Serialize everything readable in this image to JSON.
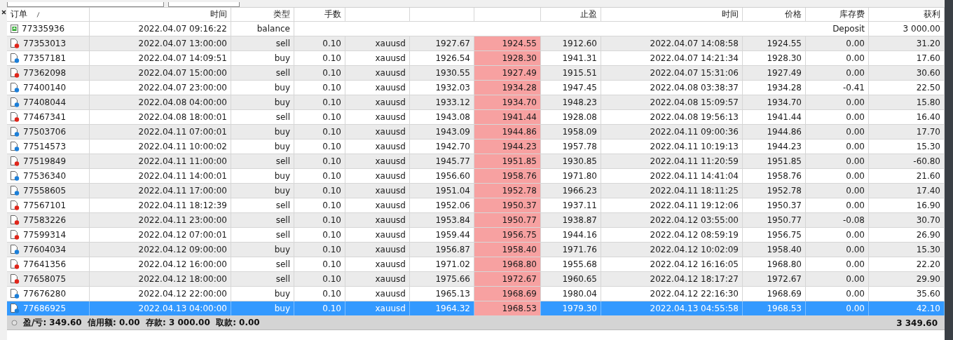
{
  "columns": {
    "order": "订单",
    "open_time": "时间",
    "type": "类型",
    "size": "手数",
    "take_profit": "止盈",
    "close_time": "时间",
    "close_price": "价格",
    "swap": "库存费",
    "profit": "获利"
  },
  "rows": [
    {
      "kind": "balance",
      "selected": false,
      "order": "77335936",
      "open_time": "2022.04.07 09:16:22",
      "type": "balance",
      "swap": "Deposit",
      "profit": "3 000.00"
    },
    {
      "kind": "sell",
      "selected": false,
      "sl_hit": true,
      "order": "77353013",
      "open_time": "2022.04.07 13:00:00",
      "type": "sell",
      "size": "0.10",
      "symbol": "xauusd",
      "open_price": "1927.67",
      "stop_loss": "1924.55",
      "take_profit": "1912.60",
      "close_time": "2022.04.07 14:08:58",
      "close_price": "1924.55",
      "swap": "0.00",
      "profit": "31.20"
    },
    {
      "kind": "buy",
      "selected": false,
      "sl_hit": true,
      "order": "77357181",
      "open_time": "2022.04.07 14:09:51",
      "type": "buy",
      "size": "0.10",
      "symbol": "xauusd",
      "open_price": "1926.54",
      "stop_loss": "1928.30",
      "take_profit": "1941.31",
      "close_time": "2022.04.07 14:21:34",
      "close_price": "1928.30",
      "swap": "0.00",
      "profit": "17.60"
    },
    {
      "kind": "sell",
      "selected": false,
      "sl_hit": true,
      "order": "77362098",
      "open_time": "2022.04.07 15:00:00",
      "type": "sell",
      "size": "0.10",
      "symbol": "xauusd",
      "open_price": "1930.55",
      "stop_loss": "1927.49",
      "take_profit": "1915.51",
      "close_time": "2022.04.07 15:31:06",
      "close_price": "1927.49",
      "swap": "0.00",
      "profit": "30.60"
    },
    {
      "kind": "buy",
      "selected": false,
      "sl_hit": true,
      "order": "77400140",
      "open_time": "2022.04.07 23:00:00",
      "type": "buy",
      "size": "0.10",
      "symbol": "xauusd",
      "open_price": "1932.03",
      "stop_loss": "1934.28",
      "take_profit": "1947.45",
      "close_time": "2022.04.08 03:38:37",
      "close_price": "1934.28",
      "swap": "-0.41",
      "profit": "22.50"
    },
    {
      "kind": "buy",
      "selected": false,
      "sl_hit": true,
      "order": "77408044",
      "open_time": "2022.04.08 04:00:00",
      "type": "buy",
      "size": "0.10",
      "symbol": "xauusd",
      "open_price": "1933.12",
      "stop_loss": "1934.70",
      "take_profit": "1948.23",
      "close_time": "2022.04.08 15:09:57",
      "close_price": "1934.70",
      "swap": "0.00",
      "profit": "15.80"
    },
    {
      "kind": "sell",
      "selected": false,
      "sl_hit": true,
      "order": "77467341",
      "open_time": "2022.04.08 18:00:01",
      "type": "sell",
      "size": "0.10",
      "symbol": "xauusd",
      "open_price": "1943.08",
      "stop_loss": "1941.44",
      "take_profit": "1928.08",
      "close_time": "2022.04.08 19:56:13",
      "close_price": "1941.44",
      "swap": "0.00",
      "profit": "16.40"
    },
    {
      "kind": "buy",
      "selected": false,
      "sl_hit": true,
      "order": "77503706",
      "open_time": "2022.04.11 07:00:01",
      "type": "buy",
      "size": "0.10",
      "symbol": "xauusd",
      "open_price": "1943.09",
      "stop_loss": "1944.86",
      "take_profit": "1958.09",
      "close_time": "2022.04.11 09:00:36",
      "close_price": "1944.86",
      "swap": "0.00",
      "profit": "17.70"
    },
    {
      "kind": "buy",
      "selected": false,
      "sl_hit": true,
      "order": "77514573",
      "open_time": "2022.04.11 10:00:02",
      "type": "buy",
      "size": "0.10",
      "symbol": "xauusd",
      "open_price": "1942.70",
      "stop_loss": "1944.23",
      "take_profit": "1957.78",
      "close_time": "2022.04.11 10:19:13",
      "close_price": "1944.23",
      "swap": "0.00",
      "profit": "15.30"
    },
    {
      "kind": "sell",
      "selected": false,
      "sl_hit": true,
      "order": "77519849",
      "open_time": "2022.04.11 11:00:00",
      "type": "sell",
      "size": "0.10",
      "symbol": "xauusd",
      "open_price": "1945.77",
      "stop_loss": "1951.85",
      "take_profit": "1930.85",
      "close_time": "2022.04.11 11:20:59",
      "close_price": "1951.85",
      "swap": "0.00",
      "profit": "-60.80"
    },
    {
      "kind": "buy",
      "selected": false,
      "sl_hit": true,
      "order": "77536340",
      "open_time": "2022.04.11 14:00:01",
      "type": "buy",
      "size": "0.10",
      "symbol": "xauusd",
      "open_price": "1956.60",
      "stop_loss": "1958.76",
      "take_profit": "1971.80",
      "close_time": "2022.04.11 14:41:04",
      "close_price": "1958.76",
      "swap": "0.00",
      "profit": "21.60"
    },
    {
      "kind": "buy",
      "selected": false,
      "sl_hit": true,
      "order": "77558605",
      "open_time": "2022.04.11 17:00:00",
      "type": "buy",
      "size": "0.10",
      "symbol": "xauusd",
      "open_price": "1951.04",
      "stop_loss": "1952.78",
      "take_profit": "1966.23",
      "close_time": "2022.04.11 18:11:25",
      "close_price": "1952.78",
      "swap": "0.00",
      "profit": "17.40"
    },
    {
      "kind": "sell",
      "selected": false,
      "sl_hit": true,
      "order": "77567101",
      "open_time": "2022.04.11 18:12:39",
      "type": "sell",
      "size": "0.10",
      "symbol": "xauusd",
      "open_price": "1952.06",
      "stop_loss": "1950.37",
      "take_profit": "1937.11",
      "close_time": "2022.04.11 19:12:06",
      "close_price": "1950.37",
      "swap": "0.00",
      "profit": "16.90"
    },
    {
      "kind": "sell",
      "selected": false,
      "sl_hit": true,
      "order": "77583226",
      "open_time": "2022.04.11 23:00:00",
      "type": "sell",
      "size": "0.10",
      "symbol": "xauusd",
      "open_price": "1953.84",
      "stop_loss": "1950.77",
      "take_profit": "1938.87",
      "close_time": "2022.04.12 03:55:00",
      "close_price": "1950.77",
      "swap": "-0.08",
      "profit": "30.70"
    },
    {
      "kind": "sell",
      "selected": false,
      "sl_hit": true,
      "order": "77599314",
      "open_time": "2022.04.12 07:00:01",
      "type": "sell",
      "size": "0.10",
      "symbol": "xauusd",
      "open_price": "1959.44",
      "stop_loss": "1956.75",
      "take_profit": "1944.16",
      "close_time": "2022.04.12 08:59:19",
      "close_price": "1956.75",
      "swap": "0.00",
      "profit": "26.90"
    },
    {
      "kind": "buy",
      "selected": false,
      "sl_hit": true,
      "order": "77604034",
      "open_time": "2022.04.12 09:00:00",
      "type": "buy",
      "size": "0.10",
      "symbol": "xauusd",
      "open_price": "1956.87",
      "stop_loss": "1958.40",
      "take_profit": "1971.76",
      "close_time": "2022.04.12 10:02:09",
      "close_price": "1958.40",
      "swap": "0.00",
      "profit": "15.30"
    },
    {
      "kind": "sell",
      "selected": false,
      "sl_hit": true,
      "order": "77641356",
      "open_time": "2022.04.12 16:00:00",
      "type": "sell",
      "size": "0.10",
      "symbol": "xauusd",
      "open_price": "1971.02",
      "stop_loss": "1968.80",
      "take_profit": "1955.68",
      "close_time": "2022.04.12 16:16:05",
      "close_price": "1968.80",
      "swap": "0.00",
      "profit": "22.20"
    },
    {
      "kind": "sell",
      "selected": false,
      "sl_hit": true,
      "order": "77658075",
      "open_time": "2022.04.12 18:00:00",
      "type": "sell",
      "size": "0.10",
      "symbol": "xauusd",
      "open_price": "1975.66",
      "stop_loss": "1972.67",
      "take_profit": "1960.65",
      "close_time": "2022.04.12 18:17:27",
      "close_price": "1972.67",
      "swap": "0.00",
      "profit": "29.90"
    },
    {
      "kind": "buy",
      "selected": false,
      "sl_hit": true,
      "order": "77676280",
      "open_time": "2022.04.12 22:00:00",
      "type": "buy",
      "size": "0.10",
      "symbol": "xauusd",
      "open_price": "1965.13",
      "stop_loss": "1968.69",
      "take_profit": "1980.04",
      "close_time": "2022.04.12 22:16:30",
      "close_price": "1968.69",
      "swap": "0.00",
      "profit": "35.60"
    },
    {
      "kind": "buy",
      "selected": true,
      "sl_hit": true,
      "order": "77686925",
      "open_time": "2022.04.13 04:00:00",
      "type": "buy",
      "size": "0.10",
      "symbol": "xauusd",
      "open_price": "1964.32",
      "stop_loss": "1968.53",
      "take_profit": "1979.30",
      "close_time": "2022.04.13 04:55:58",
      "close_price": "1968.53",
      "swap": "0.00",
      "profit": "42.10"
    }
  ],
  "summary": {
    "text": "盈/亏: 349.60  信用额: 0.00  存款: 3 000.00  取款: 0.00",
    "total": "3 349.60"
  }
}
